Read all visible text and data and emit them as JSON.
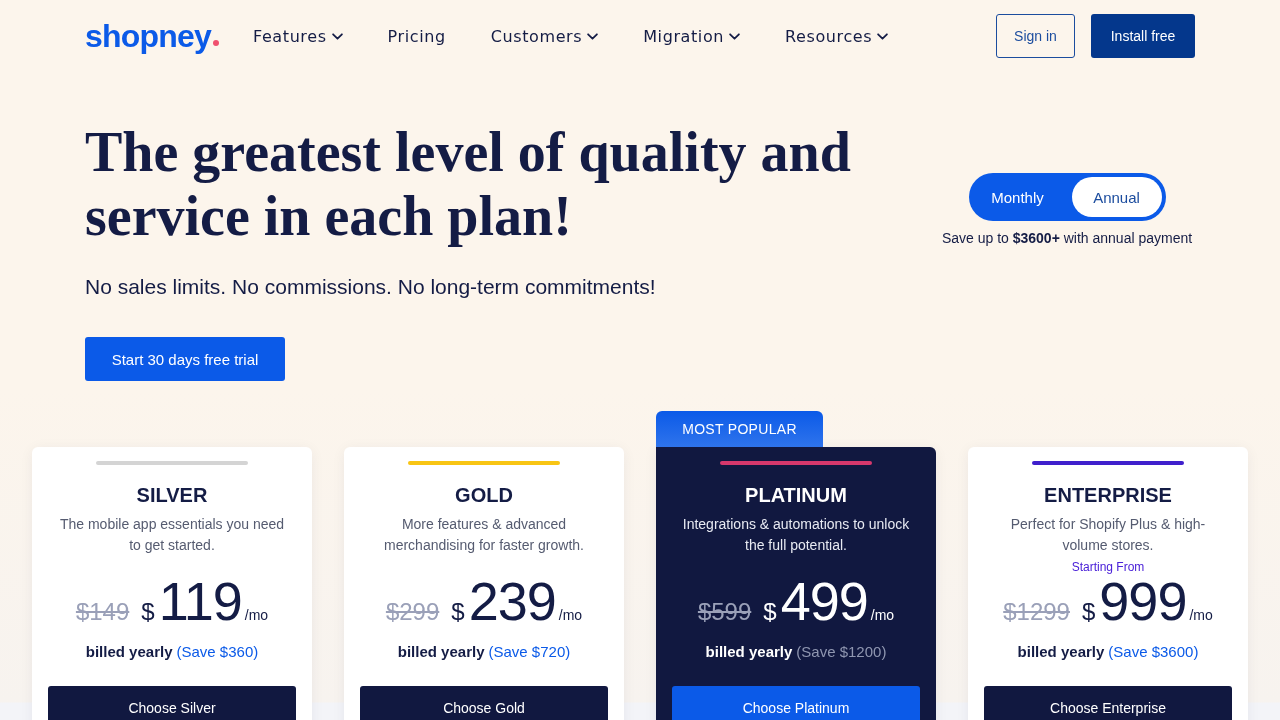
{
  "header": {
    "logo": "shopney",
    "nav": [
      {
        "label": "Features",
        "dropdown": true
      },
      {
        "label": "Pricing",
        "dropdown": false
      },
      {
        "label": "Customers",
        "dropdown": true
      },
      {
        "label": "Migration",
        "dropdown": true
      },
      {
        "label": "Resources",
        "dropdown": true
      }
    ],
    "sign_in": "Sign in",
    "install": "Install free"
  },
  "hero": {
    "title": "The greatest level of quality and service in each plan!",
    "subtitle": "No sales limits. No commissions. No long-term commitments!",
    "cta": "Start 30 days free trial"
  },
  "billing": {
    "options": [
      {
        "label": "Monthly",
        "selected": false
      },
      {
        "label": "Annual",
        "selected": true
      }
    ],
    "note": "Save up to **$3600+** with annual payment"
  },
  "plans": [
    {
      "name": "SILVER",
      "color": "#d4d4d4",
      "featured": false,
      "description": "The mobile app essentials you need to get started.",
      "old_price": "$149",
      "currency": "$",
      "price": "119",
      "period": "/mo",
      "billing": "billed yearly",
      "savings": "(Save $360)",
      "button": "Choose Silver"
    },
    {
      "name": "GOLD",
      "color": "#f8c514",
      "featured": false,
      "description": "More features & advanced merchandising for faster growth.",
      "old_price": "$299",
      "currency": "$",
      "price": "239",
      "period": "/mo",
      "billing": "billed yearly",
      "savings": "(Save $720)",
      "button": "Choose Gold"
    },
    {
      "name": "PLATINUM",
      "color": "#d6386c",
      "featured": true,
      "badge": "MOST POPULAR",
      "description": "Integrations & automations to unlock the full potential.",
      "old_price": "$599",
      "currency": "$",
      "price": "499",
      "period": "/mo",
      "billing": "billed yearly",
      "savings": "(Save $1200)",
      "button": "Choose Platinum"
    },
    {
      "name": "ENTERPRISE",
      "color": "#3f1fcc",
      "featured": false,
      "description": "Perfect for Shopify Plus & high-volume stores.",
      "starting_label": "Starting From",
      "old_price": "$1299",
      "currency": "$",
      "price": "999",
      "period": "/mo",
      "billing": "billed yearly",
      "savings": "(Save $3600)",
      "button": "Choose Enterprise"
    }
  ]
}
